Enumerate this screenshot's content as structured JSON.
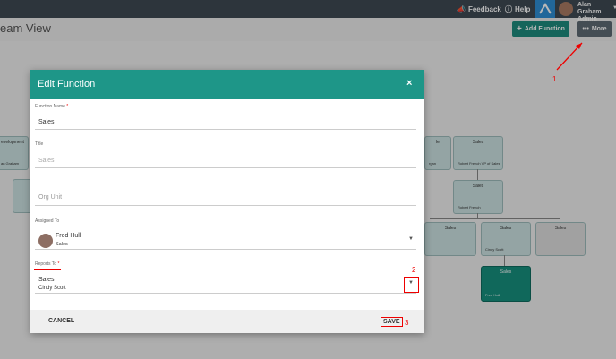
{
  "topbar": {
    "feedback": "Feedback",
    "help": "Help",
    "user_name": "Alan Graham",
    "user_role": "Admin"
  },
  "page": {
    "title": "eam View",
    "add_function": "Add Function",
    "more": "More"
  },
  "orgchart": {
    "nodes": [
      {
        "title": "evelopment",
        "person": "an Graham"
      },
      {
        "title": "le",
        "person": "rgan"
      },
      {
        "title": "Sales",
        "person": "Robert French VP of Sales"
      },
      {
        "title": "Sales",
        "person": "Robert French"
      },
      {
        "title": "Sales",
        "person": ""
      },
      {
        "title": "Sales",
        "person": "Cindy Scott"
      },
      {
        "title": "Sales",
        "person": ""
      },
      {
        "title": "Sales",
        "person": "Fred Hull"
      }
    ]
  },
  "modal": {
    "title": "Edit Function",
    "close": "×",
    "function_name_label": "Function Name",
    "function_name_value": "Sales",
    "title_label": "Title",
    "title_placeholder": "Sales",
    "org_unit_placeholder": "Org Unit",
    "assigned_to_label": "Assigned To",
    "assigned_name": "Fred Hull",
    "assigned_role": "Sales",
    "reports_to_label": "Reports To",
    "reports_to_value": "Sales",
    "reports_to_person": "Cindy Scott",
    "cancel": "CANCEL",
    "save": "SAVE",
    "required_mark": "*"
  },
  "annotations": {
    "a1": "1",
    "a2": "2",
    "a3": "3"
  },
  "colors": {
    "accent": "#1e9688",
    "annotation": "#e00000"
  }
}
